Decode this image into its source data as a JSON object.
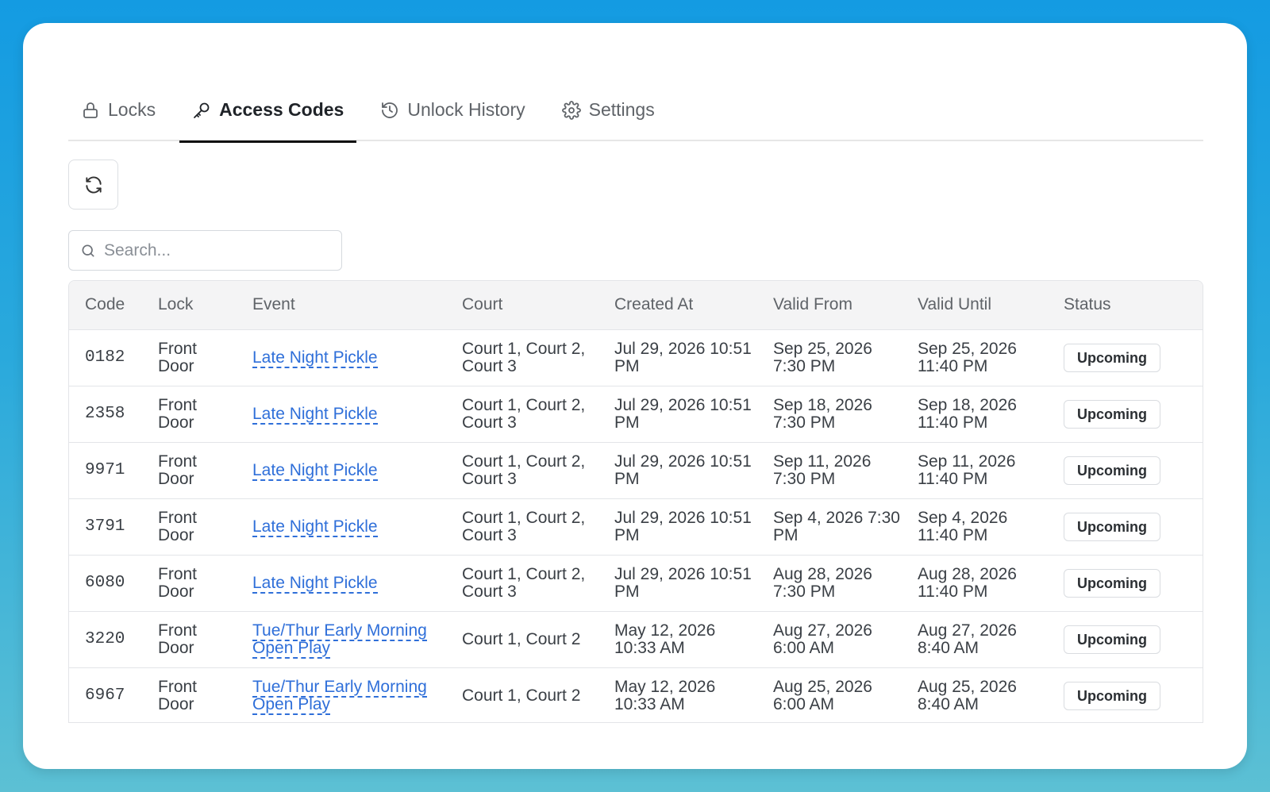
{
  "tabs": [
    {
      "label": "Locks",
      "icon": "lock-icon",
      "active": false
    },
    {
      "label": "Access Codes",
      "icon": "key-icon",
      "active": true
    },
    {
      "label": "Unlock History",
      "icon": "history-icon",
      "active": false
    },
    {
      "label": "Settings",
      "icon": "gear-icon",
      "active": false
    }
  ],
  "toolbar": {
    "refresh_icon": "refresh-icon"
  },
  "search": {
    "placeholder": "Search..."
  },
  "table": {
    "columns": [
      "Code",
      "Lock",
      "Event",
      "Court",
      "Created At",
      "Valid From",
      "Valid Until",
      "Status"
    ],
    "rows": [
      {
        "code": "0182",
        "lock": "Front Door",
        "event": "Late Night Pickle",
        "court": "Court 1, Court 2, Court 3",
        "created": "Jul 29, 2026 10:51 PM",
        "from": "Sep 25, 2026 7:30 PM",
        "until": "Sep 25, 2026 11:40 PM",
        "status": "Upcoming"
      },
      {
        "code": "2358",
        "lock": "Front Door",
        "event": "Late Night Pickle",
        "court": "Court 1, Court 2, Court 3",
        "created": "Jul 29, 2026 10:51 PM",
        "from": "Sep 18, 2026 7:30 PM",
        "until": "Sep 18, 2026 11:40 PM",
        "status": "Upcoming"
      },
      {
        "code": "9971",
        "lock": "Front Door",
        "event": "Late Night Pickle",
        "court": "Court 1, Court 2, Court 3",
        "created": "Jul 29, 2026 10:51 PM",
        "from": "Sep 11, 2026 7:30 PM",
        "until": "Sep 11, 2026 11:40 PM",
        "status": "Upcoming"
      },
      {
        "code": "3791",
        "lock": "Front Door",
        "event": "Late Night Pickle",
        "court": "Court 1, Court 2, Court 3",
        "created": "Jul 29, 2026 10:51 PM",
        "from": "Sep 4, 2026 7:30 PM",
        "until": "Sep 4, 2026 11:40 PM",
        "status": "Upcoming"
      },
      {
        "code": "6080",
        "lock": "Front Door",
        "event": "Late Night Pickle",
        "court": "Court 1, Court 2, Court 3",
        "created": "Jul 29, 2026 10:51 PM",
        "from": "Aug 28, 2026 7:30 PM",
        "until": "Aug 28, 2026 11:40 PM",
        "status": "Upcoming"
      },
      {
        "code": "3220",
        "lock": "Front Door",
        "event": "Tue/Thur Early Morning Open Play",
        "court": "Court 1, Court 2",
        "created": "May 12, 2026 10:33 AM",
        "from": "Aug 27, 2026 6:00 AM",
        "until": "Aug 27, 2026 8:40 AM",
        "status": "Upcoming"
      },
      {
        "code": "6967",
        "lock": "Front Door",
        "event": "Tue/Thur Early Morning Open Play",
        "court": "Court 1, Court 2",
        "created": "May 12, 2026 10:33 AM",
        "from": "Aug 25, 2026 6:00 AM",
        "until": "Aug 25, 2026 8:40 AM",
        "status": "Upcoming"
      }
    ]
  }
}
